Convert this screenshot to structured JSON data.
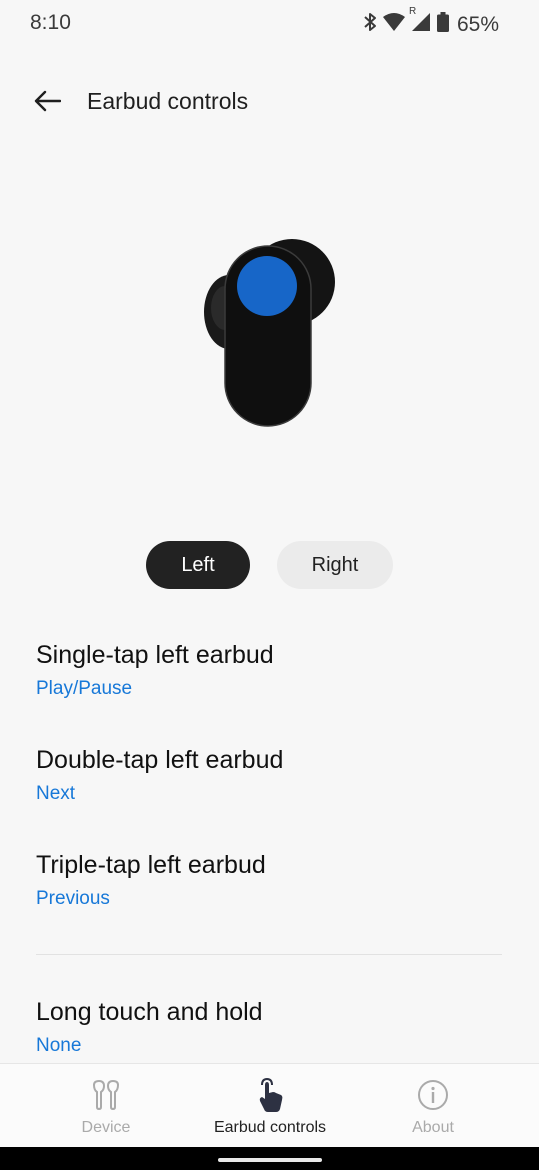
{
  "status_bar": {
    "time": "8:10",
    "battery_percent": "65%",
    "roaming_label": "R"
  },
  "header": {
    "title": "Earbud controls"
  },
  "earbud": {
    "accent_color": "#1766c8"
  },
  "toggle": {
    "left_label": "Left",
    "right_label": "Right",
    "selected": "Left"
  },
  "settings": [
    {
      "title": "Single-tap left earbud",
      "value": "Play/Pause"
    },
    {
      "title": "Double-tap left earbud",
      "value": "Next"
    },
    {
      "title": "Triple-tap left earbud",
      "value": "Previous"
    },
    {
      "title": "Long touch and hold",
      "value": "None"
    }
  ],
  "bottom_nav": {
    "items": [
      {
        "label": "Device",
        "icon": "earbuds-icon",
        "active": false
      },
      {
        "label": "Earbud controls",
        "icon": "touch-icon",
        "active": true
      },
      {
        "label": "About",
        "icon": "info-icon",
        "active": false
      }
    ]
  },
  "colors": {
    "accent": "#1778d8",
    "background": "#f7f7f7",
    "selected_toggle": "#222222"
  }
}
